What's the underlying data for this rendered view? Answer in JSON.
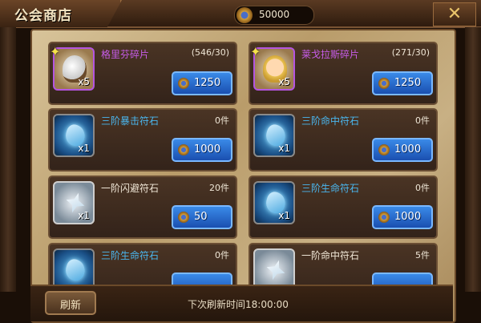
{
  "header": {
    "title": "公会商店",
    "currency_amount": "50000",
    "close_label": "✕"
  },
  "items": [
    {
      "name": "格里芬碎片",
      "count": "(546/30)",
      "qty": "x5",
      "price": "1250",
      "rarity": "purple",
      "icon": "griffin-eagle-portrait"
    },
    {
      "name": "莱戈拉斯碎片",
      "count": "(271/30)",
      "qty": "x5",
      "price": "1250",
      "rarity": "purple",
      "icon": "legolas-elf-portrait"
    },
    {
      "name": "三阶暴击符石",
      "count": "0件",
      "qty": "x1",
      "price": "1000",
      "rarity": "blue",
      "icon": "crit-rune-stone"
    },
    {
      "name": "三阶命中符石",
      "count": "0件",
      "qty": "x1",
      "price": "1000",
      "rarity": "blue",
      "icon": "hit-rune-stone"
    },
    {
      "name": "一阶闪避符石",
      "count": "20件",
      "qty": "x1",
      "price": "50",
      "rarity": "white",
      "icon": "dodge-rune-stone"
    },
    {
      "name": "三阶生命符石",
      "count": "0件",
      "qty": "x1",
      "price": "1000",
      "rarity": "blue",
      "icon": "life-rune-stone"
    },
    {
      "name": "三阶生命符石",
      "count": "0件",
      "qty": "",
      "price": "",
      "rarity": "blue",
      "icon": "life-rune-stone"
    },
    {
      "name": "一阶命中符石",
      "count": "5件",
      "qty": "",
      "price": "",
      "rarity": "white",
      "icon": "hit-rune-stone"
    }
  ],
  "footer": {
    "refresh_label": "刷新",
    "next_refresh_text": "下次刷新时间18:00:00"
  },
  "colors": {
    "purple_name": "#c65ce8",
    "blue_name": "#4ab6ee",
    "price_button": "#2a6fd0"
  }
}
